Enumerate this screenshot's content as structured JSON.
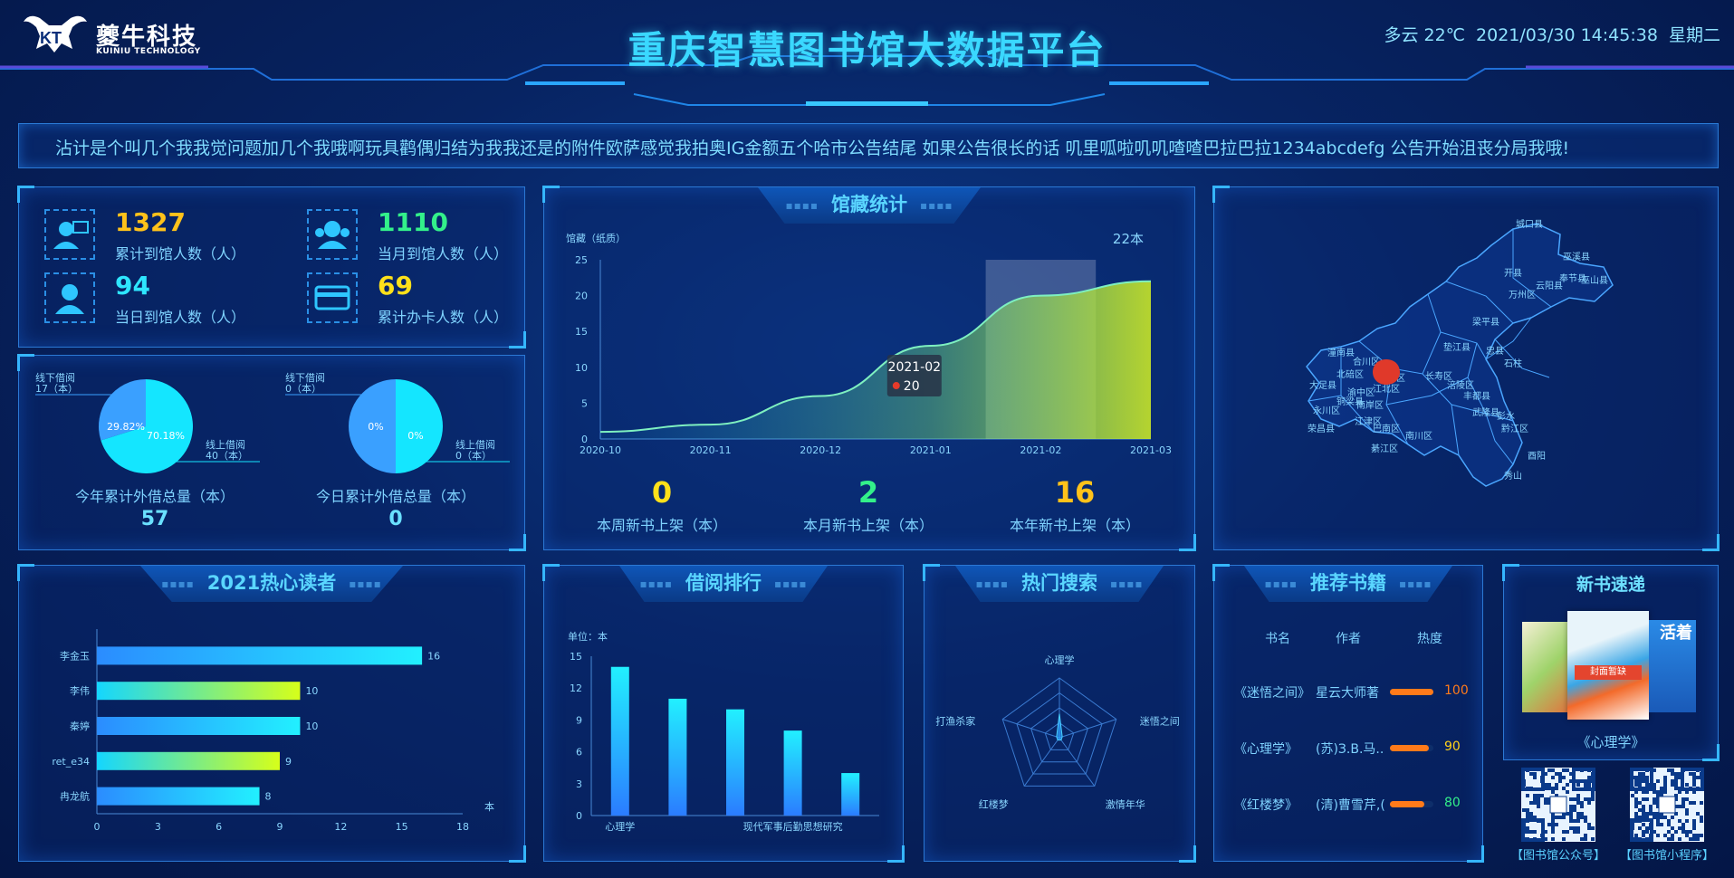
{
  "header": {
    "logo_text": "夔牛科技",
    "logo_sub": "KUINIU TECHNOLOGY",
    "title": "重庆智慧图书馆大数据平台",
    "weather": "多云 22℃",
    "datetime": "2021/03/30 14:45:38",
    "weekday": "星期二"
  },
  "notice": {
    "text": "沾计是个叫几个我我觉问题加几个我哦啊玩具鹳偶归结为我我还是的附件欧萨感觉我拍奥IG金额五个哈市公告结尾    如果公告很长的话 叽里呱啦叽叽喳喳巴拉巴拉1234abcdefg     公告开始沮丧分局我哦!"
  },
  "stats": [
    {
      "value": "1327",
      "label": "累计到馆人数（人）",
      "color": "#ffc21a",
      "icon": "monitor-person-icon"
    },
    {
      "value": "1110",
      "label": "当月到馆人数（人）",
      "color": "#33f08a",
      "icon": "group-icon"
    },
    {
      "value": "94",
      "label": "当日到馆人数（人）",
      "color": "#2ee6ff",
      "icon": "person-icon"
    },
    {
      "value": "69",
      "label": "累计办卡人数（人）",
      "color": "#ffe11a",
      "icon": "card-icon"
    }
  ],
  "pies": [
    {
      "title": "今年累计外借总量（本）",
      "total": "57",
      "label_offline": "线下借阅",
      "label_offline_count": "17（本）",
      "label_online": "线上借阅",
      "label_online_count": "40（本）",
      "pct_offline": "29.82%",
      "pct_online": "70.18%"
    },
    {
      "title": "今日累计外借总量（本）",
      "total": "0",
      "label_offline": "线下借阅",
      "label_offline_count": "0（本）",
      "label_online": "线上借阅",
      "label_online_count": "0（本）",
      "pct_offline": "0%",
      "pct_online": "0%"
    }
  ],
  "collection": {
    "title": "馆藏统计",
    "unit_label": "馆藏（纸质）",
    "top_label": "22本",
    "tooltip_date": "2021-02",
    "tooltip_value": "20",
    "summary": [
      {
        "value": "0",
        "label": "本周新书上架（本）",
        "color": "#ffe11a"
      },
      {
        "value": "2",
        "label": "本月新书上架（本）",
        "color": "#33f08a"
      },
      {
        "value": "16",
        "label": "本年新书上架（本）",
        "color": "#ffc21a"
      }
    ]
  },
  "map": {
    "labels": [
      "城口县",
      "巫溪县",
      "开县",
      "云阳县",
      "奉节县",
      "巫山县",
      "万州区",
      "梁平县",
      "垫江县",
      "忠县",
      "石柱",
      "长寿区",
      "涪陵区",
      "丰都县",
      "武隆县",
      "彭水",
      "黔江区",
      "酉阳",
      "秀山",
      "潼南县",
      "合川区",
      "北碚区",
      "渝北区",
      "江北区",
      "渝中区",
      "南岸区",
      "巴南区",
      "南川区",
      "綦江区",
      "大足县",
      "永川区",
      "江津区",
      "荣昌县",
      "铜梁县"
    ]
  },
  "readers": {
    "title": "2021热心读者",
    "unit": "本"
  },
  "borrow": {
    "title": "借阅排行",
    "unit_label": "单位：本",
    "cat_first": "心理学",
    "cat_last": "现代军事后勤思想研究"
  },
  "search": {
    "title": "热门搜索",
    "indicators": [
      "心理学",
      "迷悟之间",
      "激情年华",
      "红楼梦",
      "打渔杀家"
    ]
  },
  "recommend": {
    "title": "推荐书籍",
    "headers": [
      "书名",
      "作者",
      "热度"
    ],
    "rows": [
      {
        "name": "《迷悟之间》",
        "author": "星云大师著",
        "heat": "100",
        "heat_color": "#ff7a1a",
        "level": 1.0
      },
      {
        "name": "《心理学》",
        "author": "(苏)З.В.马...",
        "heat": "90",
        "heat_color": "#ffd21a",
        "level": 0.9
      },
      {
        "name": "《红楼梦》",
        "author": "(清)曹雪芹,(...",
        "heat": "80",
        "heat_color": "#33f08a",
        "level": 0.8
      }
    ]
  },
  "newbooks": {
    "title": "新书速递",
    "book": "《心理学》",
    "cover_text": "封面暂缺",
    "side_text": "活着"
  },
  "qr": [
    {
      "label": "【图书馆公众号】"
    },
    {
      "label": "【图书馆小程序】"
    }
  ],
  "chart_data": [
    {
      "type": "area",
      "title": "馆藏统计",
      "ylabel": "馆藏（纸质）",
      "x": [
        "2020-10",
        "2020-11",
        "2020-12",
        "2021-01",
        "2021-02",
        "2021-03"
      ],
      "values": [
        1,
        2,
        6,
        13,
        20,
        22
      ],
      "ylim": [
        0,
        25
      ],
      "yticks": [
        0,
        5,
        10,
        15,
        20,
        25
      ]
    },
    {
      "type": "bar",
      "title": "2021热心读者",
      "orientation": "horizontal",
      "categories": [
        "李金玉",
        "李伟",
        "秦婷",
        "ret_e34",
        "冉龙航"
      ],
      "values": [
        16,
        10,
        10,
        9,
        8
      ],
      "xlim": [
        0,
        18
      ],
      "xticks": [
        0,
        3,
        6,
        9,
        12,
        15,
        18
      ],
      "xlabel": "本"
    },
    {
      "type": "bar",
      "title": "借阅排行",
      "ylabel": "单位：本",
      "categories": [
        "心理学",
        "",
        "",
        "",
        "现代军事后勤思想研究"
      ],
      "values": [
        14,
        11,
        10,
        8,
        4
      ],
      "ylim": [
        0,
        15
      ],
      "yticks": [
        0,
        3,
        6,
        9,
        12,
        15
      ]
    },
    {
      "type": "radar",
      "title": "热门搜索",
      "indicators": [
        "心理学",
        "迷悟之间",
        "激情年华",
        "红楼梦",
        "打渔杀家"
      ],
      "values": [
        8,
        1,
        1,
        1,
        1
      ],
      "max": 20
    },
    {
      "type": "pie",
      "title": "今年累计外借总量（本）",
      "slices": [
        {
          "name": "线下借阅",
          "value": 17
        },
        {
          "name": "线上借阅",
          "value": 40
        }
      ]
    },
    {
      "type": "pie",
      "title": "今日累计外借总量（本）",
      "slices": [
        {
          "name": "线下借阅",
          "value": 0
        },
        {
          "name": "线上借阅",
          "value": 0
        }
      ]
    }
  ]
}
